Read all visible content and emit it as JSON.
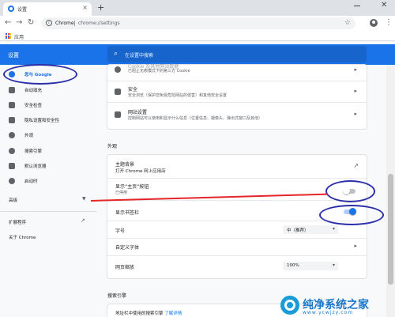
{
  "browser": {
    "tab_title": "设置",
    "tab_close": "×",
    "new_tab": "+",
    "omnibox_scheme": "Chrome",
    "omnibox_url": "chrome://settings",
    "apps_label": "应用",
    "icons": [
      "back-icon",
      "forward-icon",
      "reload-icon",
      "info-icon",
      "star-icon",
      "profile-icon",
      "menu-icon",
      "apps-icon"
    ]
  },
  "header": {
    "title": "设置",
    "search_placeholder": "在设置中搜索"
  },
  "sidebar": {
    "items": [
      {
        "label": "您与 Google",
        "icon": "person-icon",
        "active": true
      },
      {
        "label": "自动填充",
        "icon": "autofill-icon"
      },
      {
        "label": "安全检查",
        "icon": "shield-check-icon"
      },
      {
        "label": "隐私设置和安全性",
        "icon": "shield-icon"
      },
      {
        "label": "外观",
        "icon": "palette-icon"
      },
      {
        "label": "搜索引擎",
        "icon": "search-icon"
      },
      {
        "label": "默认浏览器",
        "icon": "browser-icon"
      },
      {
        "label": "启动时",
        "icon": "power-icon"
      }
    ],
    "advanced": "高级",
    "extensions": "扩展程序",
    "about": "关于 Chrome"
  },
  "privacy_card": {
    "rows": [
      {
        "title": "Cookie 及其他网站数据",
        "sub": "已阻止无痕模式下的第三方 Cookie",
        "icon": "cookie-icon"
      },
      {
        "title": "安全",
        "sub": "安全浏览（保护您免受危险网站的侵害）和其他安全设置",
        "icon": "security-shield-icon"
      },
      {
        "title": "网站设置",
        "sub": "控制网站可以使用和显示什么信息（位置信息、摄像头、弹出式窗口及其他）",
        "icon": "sliders-icon"
      }
    ]
  },
  "appearance": {
    "section_title": "外观",
    "theme_title": "主题背景",
    "theme_sub": "打开 Chrome 网上应用店",
    "home_button_title": "显示“主页”按钮",
    "home_button_sub": "已停用",
    "home_button_on": false,
    "bookmarks_bar_title": "显示书签栏",
    "bookmarks_bar_on": true,
    "font_size_title": "字号",
    "font_size_value": "中（推荐）",
    "custom_fonts_title": "自定义字体",
    "zoom_title": "网页缩放",
    "zoom_value": "100%"
  },
  "search_engine": {
    "section_title": "搜索引擎",
    "row_text": "地址栏中使用的搜索引擎",
    "learn_more": "了解详情"
  },
  "watermark": {
    "text": "纯净系统之家",
    "url": "www.ycwjzy.com"
  },
  "colors": {
    "accent": "#1a73e8",
    "annotation_ellipse": "#2b2fa8",
    "annotation_line": "#e4262b"
  }
}
